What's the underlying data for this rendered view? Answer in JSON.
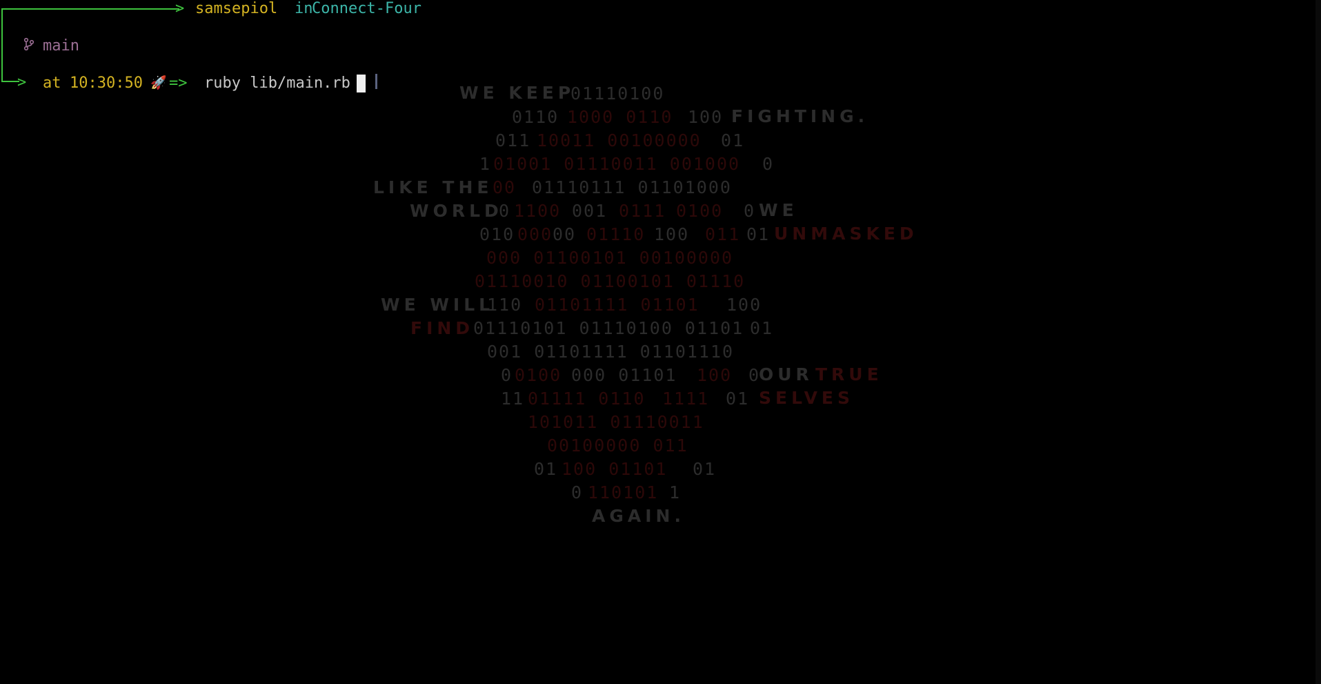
{
  "terminal": {
    "arrow": "─>",
    "user": "samsepiol",
    "in_word": "in",
    "directory": "Connect-Four",
    "branch_icon": "git-branch-icon",
    "branch": "main",
    "at_word": "at",
    "time": "10:30:50",
    "rocket": "🚀",
    "prompt_symbol": "=>",
    "command": "ruby lib/main.rb"
  },
  "colors": {
    "prompt_green": "#3ec43e",
    "user_yellow": "#d4b322",
    "dir_teal": "#3cb5a8",
    "branch_purple": "#9c6f95"
  },
  "wallpaper": {
    "words": {
      "w1": "WE KEEP",
      "w2": "FIGHTING.",
      "w3": "LIKE THE",
      "w4": "WORLD",
      "w5": "WE",
      "w6": "UNMASKED",
      "w7": "WE WILL",
      "w8": "FIND",
      "w9": "OUR",
      "w10": "TRUE",
      "w11": "SELVES",
      "w12": "AGAIN."
    },
    "binary": {
      "b1": "01110100",
      "b2": "0110",
      "b3": "1000 0110",
      "b4": "100",
      "b5": "011",
      "b6": "10011 00100000",
      "b7": " 01",
      "b8": "1",
      "b9": "01001 01110011 001000",
      "b10": "0",
      "b11": "00",
      "b12": " 01110111 01101000",
      "b13": "0",
      "b14": "1100",
      "b15": "001",
      "b16": " 0111",
      "b17": "0100 ",
      "b18": "0",
      "b19": "010",
      "b20": "000",
      "b21": "00 ",
      "b22": "01110",
      "b23": "100 ",
      "b24": "011",
      "b25": "01",
      "b26": "000 01100101 00100000",
      "b27": "01110010 01100101 01110",
      "b28": "110 ",
      "b29": "01101111 01101",
      "b30": "100",
      "b31": "01110101 01110100 01101",
      "b32": "01",
      "b33": "001 01101111 01101110",
      "b34": "0",
      "b35": "0100",
      "b36": "000 01101",
      "b37": "100",
      "b38": " 0",
      "b39": "11",
      "b40": "01111 0110",
      "b41": "1111",
      "b42": " 01",
      "b43": "101011 01110011",
      "b44": "00100000 011",
      "b45": "01",
      "b46": "100 01101",
      "b47": "01",
      "b48": "0",
      "b49": "110101",
      "b50": "1"
    }
  }
}
